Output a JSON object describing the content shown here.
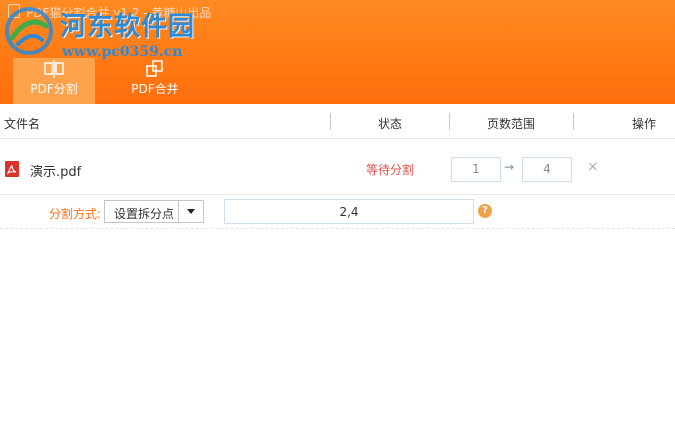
{
  "app": {
    "title": "PDF猫分割合并 v1.2 - 黄糖山出品"
  },
  "watermark": {
    "name": "河东软件园",
    "url": "www.pc0359.cn"
  },
  "tabs": [
    {
      "label": "PDF分割",
      "icon": "split-icon",
      "active": true
    },
    {
      "label": "PDF合并",
      "icon": "merge-icon",
      "active": false
    }
  ],
  "table": {
    "headers": {
      "filename": "文件名",
      "status": "状态",
      "page_range": "页数范围",
      "action": "操作"
    },
    "rows": [
      {
        "icon": "pdf-file-icon",
        "name": "演示.pdf",
        "status": "等待分割",
        "range_start": "1",
        "range_arrow": "→",
        "range_end": "4",
        "delete": "×"
      }
    ]
  },
  "split": {
    "label": "分割方式:",
    "method_selected": "设置拆分点",
    "value": "2,4",
    "help": "?"
  },
  "colors": {
    "header_orange": "#ff7a14",
    "active_tab": "#ffa24c",
    "status_red": "#d9534f",
    "label_orange": "#ff6e0e",
    "watermark_blue": "#2f8ad3"
  }
}
